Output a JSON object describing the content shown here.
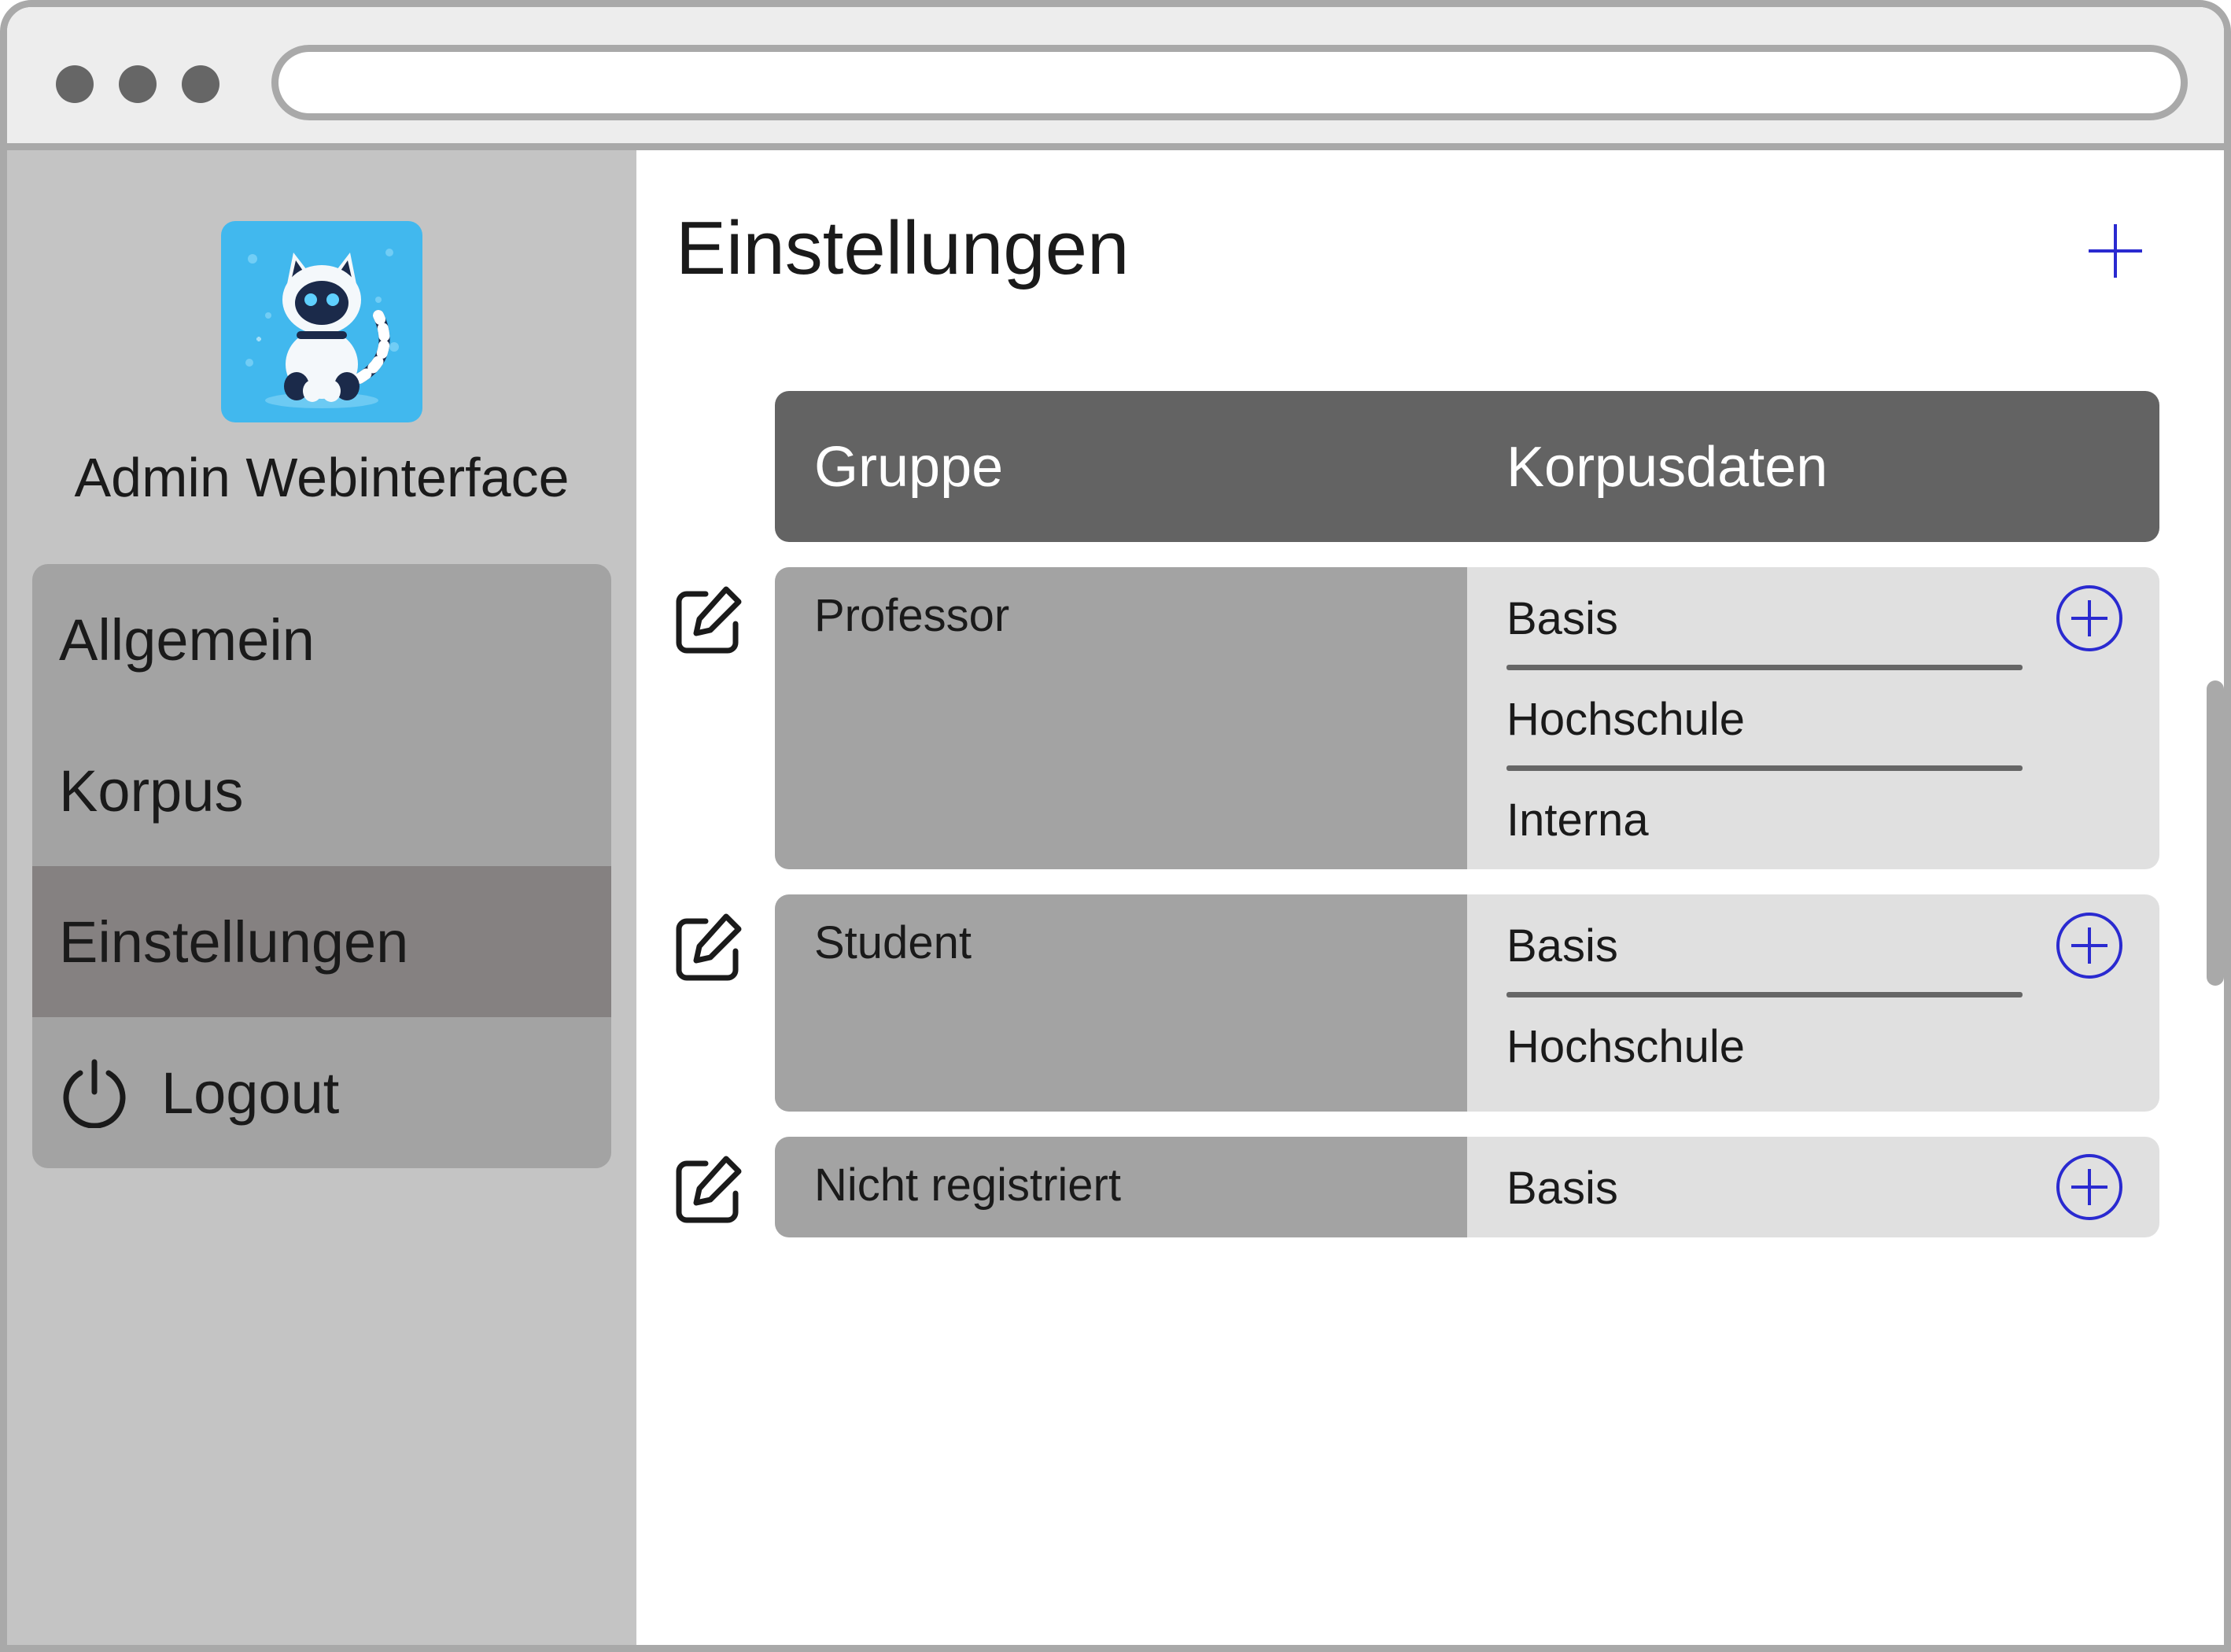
{
  "window": {
    "url": ""
  },
  "sidebar": {
    "app_name": "Admin Webinterface",
    "nav": [
      {
        "label": "Allgemein",
        "active": false
      },
      {
        "label": "Korpus",
        "active": false
      },
      {
        "label": "Einstellungen",
        "active": true
      },
      {
        "label": "Logout",
        "active": false,
        "icon": "power-icon"
      }
    ]
  },
  "main": {
    "title": "Einstellungen",
    "table": {
      "headers": [
        "Gruppe",
        "Korpusdaten"
      ],
      "rows": [
        {
          "group": "Professor",
          "corpora": [
            "Basis",
            "Hochschule",
            "Interna"
          ]
        },
        {
          "group": "Student",
          "corpora": [
            "Basis",
            "Hochschule"
          ]
        },
        {
          "group": "Nicht registriert",
          "corpora": [
            "Basis"
          ]
        }
      ]
    }
  },
  "colors": {
    "accent": "#2a2ad0",
    "sidebar_bg": "#c4c4c4",
    "nav_bg": "#a3a3a3",
    "nav_active_bg": "#858181",
    "header_bg": "#636363",
    "group_cell_bg": "#a3a3a3",
    "corpus_cell_bg": "#e0e0e0"
  },
  "icons": {
    "edit": "edit-icon",
    "add": "plus-circle-icon",
    "add_group": "plus-icon",
    "logout": "power-icon"
  }
}
